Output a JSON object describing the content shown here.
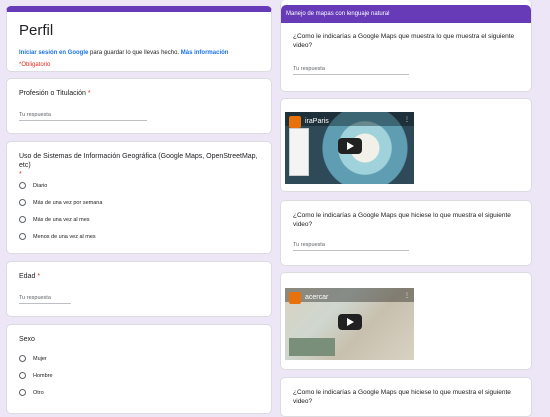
{
  "left": {
    "header": {
      "title": "Perfil",
      "signin_link": "Iniciar sesión en Google",
      "signin_text": " para guardar lo que llevas hecho. ",
      "more_info": "Más información",
      "required": "*Obligatorio"
    },
    "q1": {
      "title": "Profesión o Titulación",
      "star": "*",
      "answer": "Tu respuesta"
    },
    "q2": {
      "title": "Uso de Sistemas de Información Geográfica (Google Maps, OpenStreetMap, etc)",
      "star": "*",
      "options": [
        "Diario",
        "Más de una vez por semana",
        "Más de una vez al mes",
        "Menos de una vez al mes"
      ]
    },
    "q3": {
      "title": "Edad",
      "star": "*",
      "answer": "Tu respuesta"
    },
    "q4": {
      "title": "Sexo",
      "options": [
        "Mujer",
        "Hombre",
        "Otro"
      ]
    }
  },
  "right": {
    "section_title": "Manejo de mapas con lenguaje natural",
    "q1": {
      "title": "¿Como le indicarías a Google Maps que muestra lo que muestra el siguiente video?",
      "answer": "Tu respuesta"
    },
    "video1": {
      "title": "iraParis"
    },
    "q2": {
      "title": "¿Como le indicarías a Google Maps que hiciese lo que muestra el siguiente video?",
      "answer": "Tu respuesta"
    },
    "video2": {
      "title": "acercar"
    },
    "q3": {
      "title": "¿Como le indicarías a Google Maps que hiciese lo que muestra el siguiente video?"
    }
  },
  "colors": {
    "accent": "#673ab7",
    "required": "#d93025",
    "link": "#1a73e8",
    "background": "#ece6f6"
  }
}
